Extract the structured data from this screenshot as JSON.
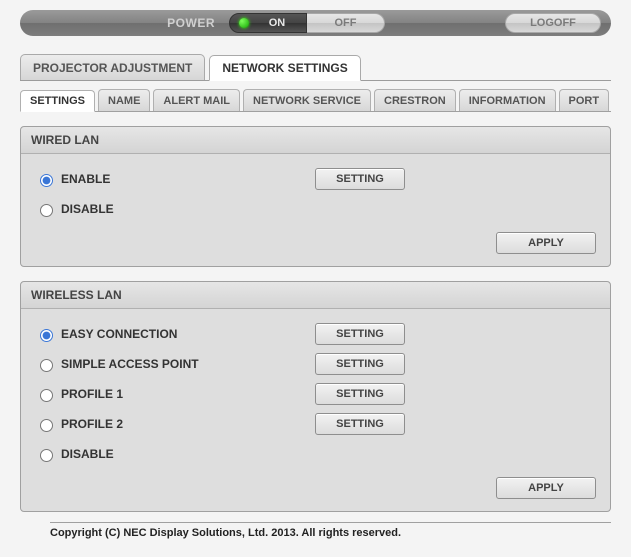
{
  "topbar": {
    "power_label": "POWER",
    "on_label": "ON",
    "off_label": "OFF",
    "logoff_label": "LOGOFF"
  },
  "main_tabs": {
    "projector_adjustment": "PROJECTOR ADJUSTMENT",
    "network_settings": "NETWORK SETTINGS"
  },
  "sub_tabs": {
    "settings": "SETTINGS",
    "name": "NAME",
    "alert_mail": "ALERT MAIL",
    "network_service": "NETWORK SERVICE",
    "crestron": "CRESTRON",
    "information": "INFORMATION",
    "port": "PORT"
  },
  "wired": {
    "title": "WIRED LAN",
    "enable": "ENABLE",
    "disable": "DISABLE",
    "setting": "SETTING",
    "apply": "APPLY",
    "selected": "enable"
  },
  "wireless": {
    "title": "WIRELESS LAN",
    "easy": "EASY CONNECTION",
    "sap": "SIMPLE ACCESS POINT",
    "p1": "PROFILE 1",
    "p2": "PROFILE 2",
    "disable": "DISABLE",
    "setting": "SETTING",
    "apply": "APPLY",
    "selected": "easy"
  },
  "footer": "Copyright (C) NEC Display Solutions, Ltd. 2013. All rights reserved."
}
